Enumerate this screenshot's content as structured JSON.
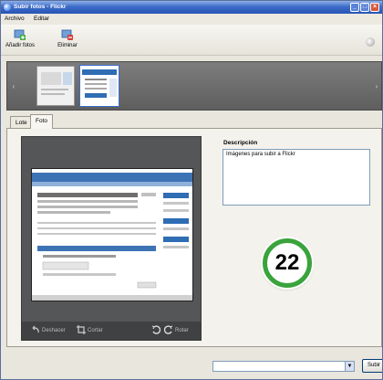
{
  "window": {
    "title": "Subir fotos - Flickr"
  },
  "menu": [
    "Archivo",
    "Editar"
  ],
  "toolbar": {
    "add_label": "Añadir fotos",
    "remove_label": "Eliminar"
  },
  "tabs": [
    "Lote",
    "Foto"
  ],
  "preview": {
    "undo_label": "Deshacer",
    "crop_label": "Cortar",
    "rotate_label": "Rotar"
  },
  "description": {
    "label": "Descripción",
    "value": "Imágenes para subir a Flickr"
  },
  "badge": {
    "number": "22"
  },
  "bottom": {
    "upload_label": "Subir"
  },
  "colors": {
    "badge_ring": "#3aa33c",
    "title_bar": "#3d6cc9",
    "preview_bg": "#545658"
  }
}
